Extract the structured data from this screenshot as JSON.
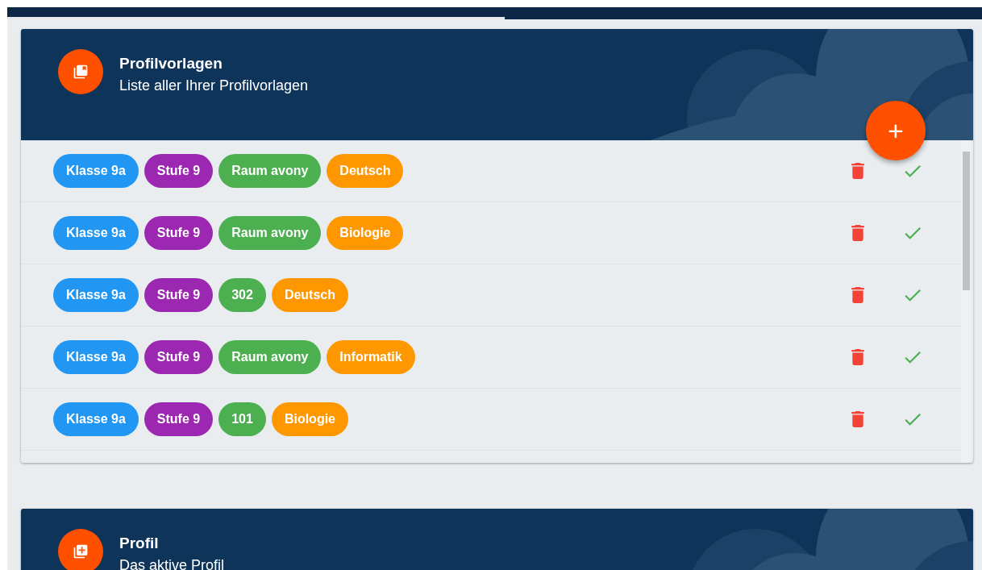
{
  "top_bar": {
    "progress": {
      "level": 0.51
    }
  },
  "cards": [
    {
      "kind": "templates",
      "title": "Profilvorlagen",
      "subtitle": "Liste aller Ihrer Profilvorlagen",
      "fab": "+",
      "rows": [
        {
          "tags": [
            {
              "kind": "class",
              "label": "Klasse 9a"
            },
            {
              "kind": "level",
              "label": "Stufe 9"
            },
            {
              "kind": "room",
              "label": "Raum avony"
            },
            {
              "kind": "subject",
              "label": "Deutsch"
            }
          ]
        },
        {
          "tags": [
            {
              "kind": "class",
              "label": "Klasse 9a"
            },
            {
              "kind": "level",
              "label": "Stufe 9"
            },
            {
              "kind": "room",
              "label": "Raum avony"
            },
            {
              "kind": "subject",
              "label": "Biologie"
            }
          ]
        },
        {
          "tags": [
            {
              "kind": "class",
              "label": "Klasse 9a"
            },
            {
              "kind": "level",
              "label": "Stufe 9"
            },
            {
              "kind": "room",
              "label": "302"
            },
            {
              "kind": "subject",
              "label": "Deutsch"
            }
          ]
        },
        {
          "tags": [
            {
              "kind": "class",
              "label": "Klasse 9a"
            },
            {
              "kind": "level",
              "label": "Stufe 9"
            },
            {
              "kind": "room",
              "label": "Raum avony"
            },
            {
              "kind": "subject",
              "label": "Informatik"
            }
          ]
        },
        {
          "tags": [
            {
              "kind": "class",
              "label": "Klasse 9a"
            },
            {
              "kind": "level",
              "label": "Stufe 9"
            },
            {
              "kind": "room",
              "label": "101"
            },
            {
              "kind": "subject",
              "label": "Biologie"
            }
          ]
        }
      ]
    },
    {
      "kind": "add",
      "title": "Profil",
      "subtitle": "Das aktive Profil"
    }
  ]
}
